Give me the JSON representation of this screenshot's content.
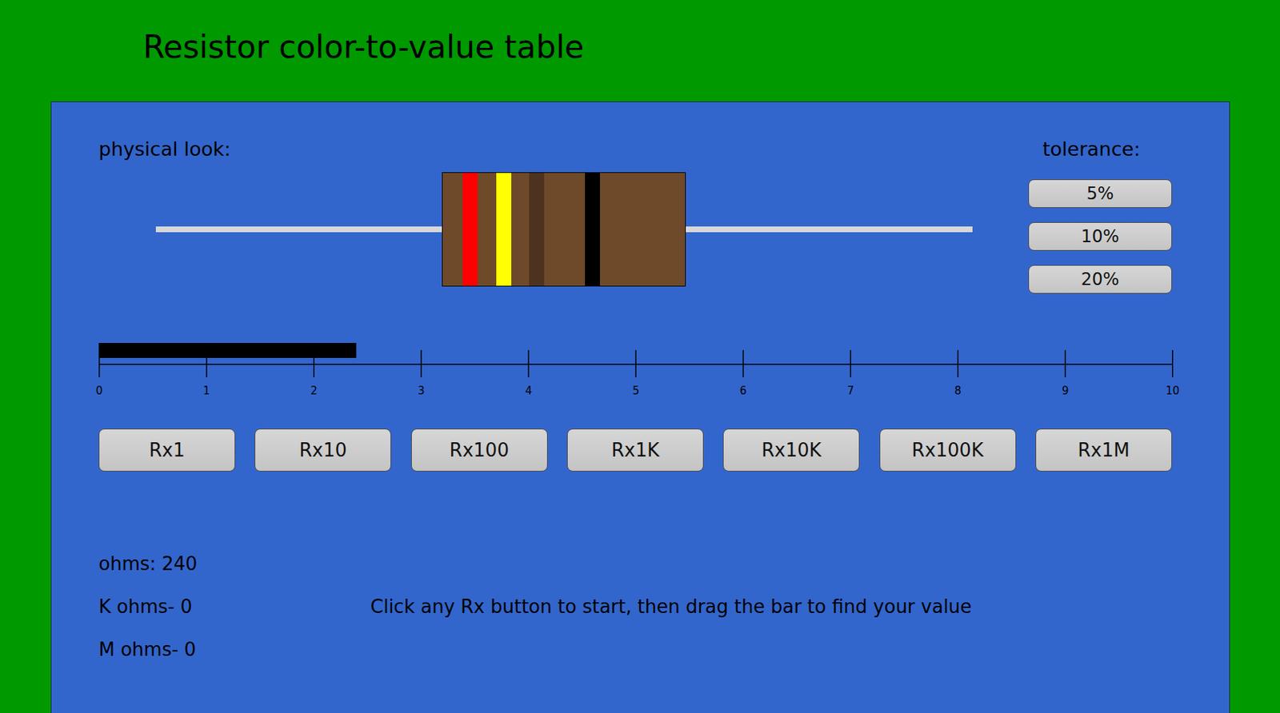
{
  "window": {
    "title": "Resistor color-to-value table"
  },
  "resistor": {
    "label": "physical look:",
    "bands": [
      {
        "color": "#ff0000"
      },
      {
        "color": "#ffff00"
      },
      {
        "color": "#4e3220"
      },
      {
        "color": "#000000"
      }
    ]
  },
  "tolerance": {
    "label": "tolerance:",
    "options": [
      "5%",
      "10%",
      "20%"
    ]
  },
  "slider": {
    "level": 0.24,
    "ticks": [
      "0",
      "1",
      "2",
      "3",
      "4",
      "5",
      "6",
      "7",
      "8",
      "9",
      "10"
    ]
  },
  "multipliers": [
    "Rx1",
    "Rx10",
    "Rx100",
    "Rx1K",
    "Rx10K",
    "Rx100K",
    "Rx1M"
  ],
  "readings": [
    "ohms: 240",
    "K ohms- 0",
    "M ohms- 0"
  ],
  "hint": "Click any Rx button to start, then drag the bar to find your value"
}
